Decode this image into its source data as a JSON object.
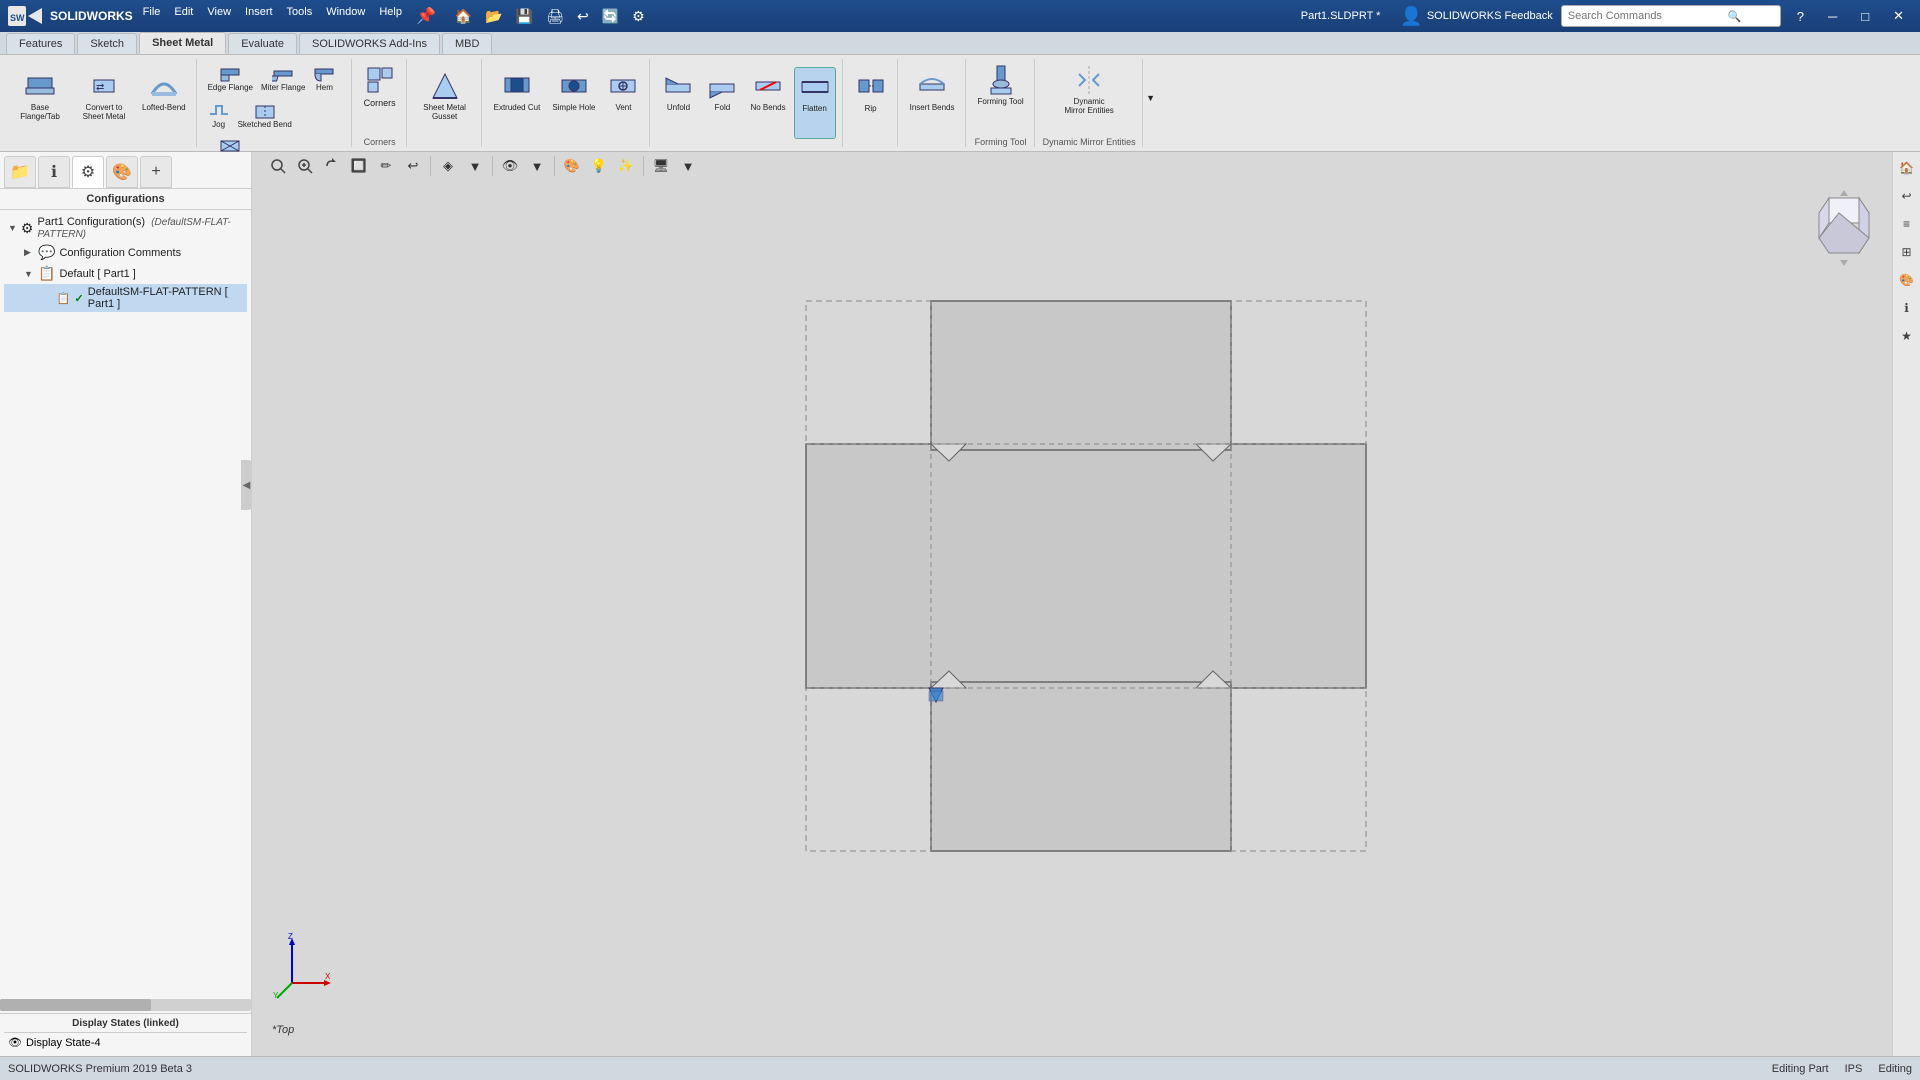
{
  "app": {
    "name": "SOLIDWORKS",
    "edition": "SOLIDWORKS Premium 2019 Beta 3",
    "filename": "Part1.SLDPRT",
    "title": "Part1.SLDPRT *"
  },
  "titlebar": {
    "menus": [
      "File",
      "Edit",
      "View",
      "Insert",
      "Tools",
      "Window",
      "Help"
    ],
    "search_placeholder": "Search Commands",
    "user": "SOLIDWORKS Feedback"
  },
  "ribbon": {
    "tabs": [
      "Features",
      "Sketch",
      "Sheet Metal",
      "Evaluate",
      "SOLIDWORKS Add-Ins",
      "MBD"
    ],
    "active_tab": "Sheet Metal",
    "groups": [
      {
        "label": "",
        "buttons": [
          {
            "id": "base-flange",
            "label": "Base Flange/Tab",
            "icon": "⬜"
          },
          {
            "id": "convert-to-sheet",
            "label": "Convert to Sheet Metal",
            "icon": "🔄"
          },
          {
            "id": "lofted-bend",
            "label": "Lofted-Bend",
            "icon": "〰️"
          }
        ]
      },
      {
        "label": "",
        "buttons_small": [
          {
            "id": "edge-flange",
            "label": "Edge Flange",
            "icon": "◻"
          },
          {
            "id": "miter-flange",
            "label": "Miter Flange",
            "icon": "◻"
          },
          {
            "id": "hem",
            "label": "Hem",
            "icon": "◻"
          },
          {
            "id": "jog",
            "label": "Jog",
            "icon": "◻"
          },
          {
            "id": "sketched-bend",
            "label": "Sketched Bend",
            "icon": "◻"
          },
          {
            "id": "cross-break",
            "label": "Cross-Break",
            "icon": "◻"
          }
        ]
      },
      {
        "label": "Corners",
        "buttons": [
          {
            "id": "corners-main",
            "label": "Corners",
            "icon": "⬡"
          }
        ]
      },
      {
        "label": "",
        "buttons": [
          {
            "id": "sheet-metal-gusset",
            "label": "Sheet Metal Gusset",
            "icon": "▲"
          }
        ]
      },
      {
        "label": "",
        "buttons": [
          {
            "id": "extruded-cut",
            "label": "Extruded Cut",
            "icon": "⬛"
          },
          {
            "id": "simple-hole",
            "label": "Simple Hole",
            "icon": "⭕"
          },
          {
            "id": "vent",
            "label": "Vent",
            "icon": "⊕"
          }
        ]
      },
      {
        "label": "",
        "buttons": [
          {
            "id": "unfold",
            "label": "Unfold",
            "icon": "◺"
          },
          {
            "id": "fold",
            "label": "Fold",
            "icon": "◿"
          },
          {
            "id": "no-bends",
            "label": "No Bends",
            "icon": "—"
          },
          {
            "id": "flatten",
            "label": "Flatten",
            "icon": "═",
            "active": true
          }
        ]
      },
      {
        "label": "",
        "buttons": [
          {
            "id": "rip",
            "label": "Rip",
            "icon": "✂"
          }
        ]
      },
      {
        "label": "",
        "buttons": [
          {
            "id": "insert-bends",
            "label": "Insert Bends",
            "icon": "〜"
          }
        ]
      },
      {
        "label": "Forming Tool",
        "buttons": [
          {
            "id": "forming-tool",
            "label": "Forming Tool",
            "icon": "🔨"
          }
        ]
      },
      {
        "label": "Dynamic Mirror Entities",
        "buttons": [
          {
            "id": "dynamic-mirror",
            "label": "Dynamic Mirror Entities",
            "icon": "⟷"
          }
        ]
      }
    ]
  },
  "left_panel": {
    "tabs": [
      "tree",
      "properties",
      "configurations",
      "palette"
    ],
    "active_tab": "configurations",
    "label": "Configurations",
    "tree": [
      {
        "id": "part1-config",
        "label": "Part1 Configuration(s)",
        "sub": "(DefaultSM-FLAT-PATTERN)",
        "level": 0,
        "expanded": true,
        "icon": "⚙"
      },
      {
        "id": "config-comments",
        "label": "Configuration Comments",
        "level": 1,
        "icon": "💬"
      },
      {
        "id": "default",
        "label": "Default [ Part1 ]",
        "level": 1,
        "expanded": true,
        "icon": "📋"
      },
      {
        "id": "default-sm",
        "label": "DefaultSM-FLAT-PATTERN [ Part1 ]",
        "level": 2,
        "icon": "📋",
        "checked": true
      }
    ],
    "display_states": {
      "label": "Display States (linked)",
      "items": [
        {
          "id": "display-state-4",
          "label": "Display State-4",
          "icon": "👁"
        }
      ]
    }
  },
  "viewport": {
    "view_label": "*Top",
    "background": "#d8d8d8"
  },
  "status_bar": {
    "app_version": "SOLIDWORKS Premium 2019 Beta 3",
    "status": "Editing Part",
    "units": "IPS",
    "editing_label": "Editing"
  },
  "view_toolbar": {
    "buttons": [
      "🔍",
      "🔎",
      "🖱",
      "👆",
      "✏",
      "🔁",
      "📐",
      "🎨",
      "💡",
      "📊",
      "🖥"
    ]
  },
  "icons": {
    "search": "🔍",
    "user": "👤",
    "help": "?",
    "minimize": "─",
    "maximize": "□",
    "close": "✕",
    "expand": "▶",
    "collapse": "▼",
    "checked": "✓",
    "unchecked": " "
  }
}
